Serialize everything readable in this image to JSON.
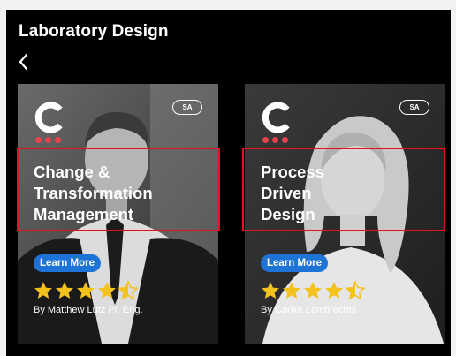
{
  "page": {
    "title": "Laboratory Design",
    "back_label": "Back"
  },
  "colors": {
    "accent_red": "#e8434d",
    "button_blue": "#1e73d6",
    "star_gold": "#f4c21c",
    "highlight_red": "#e0141f"
  },
  "cards": [
    {
      "logo_letter": "C",
      "badge": "SA",
      "title_lines": [
        "Change &",
        "Transformation",
        "Management"
      ],
      "button_label": "Learn More",
      "rating": 4.5,
      "author": "By Matthew Lutz Pr. Eng."
    },
    {
      "logo_letter": "C",
      "badge": "SA",
      "title_lines": [
        "Process",
        "Driven",
        "Design"
      ],
      "button_label": "Learn More",
      "rating": 4.5,
      "author": "By Carike Lambrechts"
    }
  ]
}
